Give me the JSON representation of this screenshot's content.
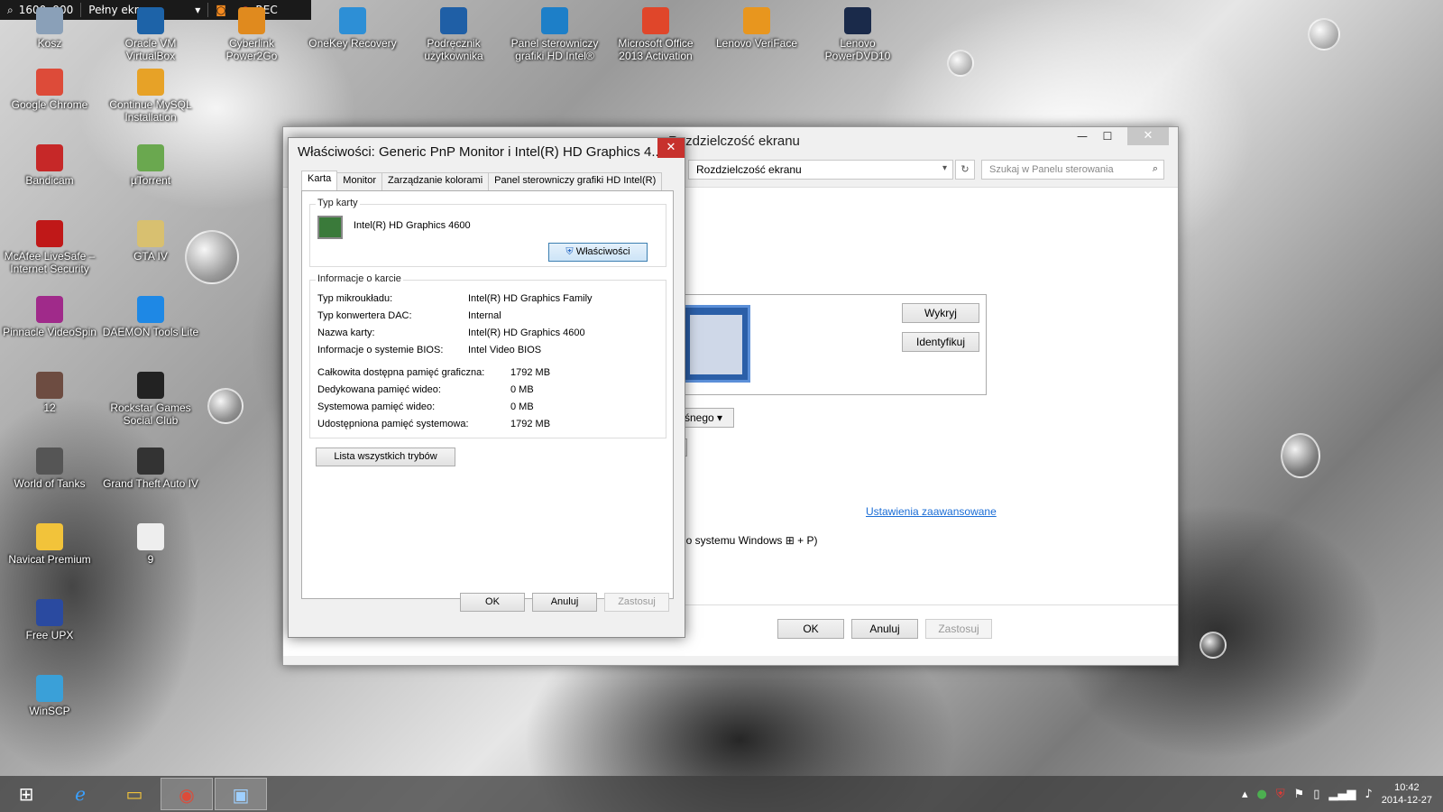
{
  "recorder": {
    "resolution": "1600x900",
    "mode": "Pełny ekran",
    "rec_label": "REC"
  },
  "desktop_icons": [
    {
      "label": "Kosz",
      "icon": "recycle-bin-icon",
      "color": "#8aa0b8"
    },
    {
      "label": "Oracle VM VirtualBox",
      "icon": "virtualbox-icon",
      "color": "#1d63a8"
    },
    {
      "label": "Cyberlink Power2Go",
      "icon": "power2go-icon",
      "color": "#e08a1e"
    },
    {
      "label": "OneKey Recovery",
      "icon": "onekey-recovery-icon",
      "color": "#2d8fd6"
    },
    {
      "label": "Podręcznik użytkownika",
      "icon": "user-guide-icon",
      "color": "#1f5fa6"
    },
    {
      "label": "Panel sterowniczy grafiki HD Intel®",
      "icon": "intel-graphics-icon",
      "color": "#1d7fc8"
    },
    {
      "label": "Microsoft Office 2013 Activation",
      "icon": "office-icon",
      "color": "#e0462a"
    },
    {
      "label": "Lenovo VeriFace",
      "icon": "veriface-icon",
      "color": "#e8961e"
    },
    {
      "label": "Lenovo PowerDVD10",
      "icon": "powerdvd-icon",
      "color": "#1a2a4a"
    },
    {
      "label": "Google Chrome",
      "icon": "chrome-icon",
      "color": "#dd4b39"
    },
    {
      "label": "Continue MySQL Installation",
      "icon": "mysql-icon",
      "color": "#e7a227"
    },
    {
      "label": "Bandicam",
      "icon": "bandicam-icon",
      "color": "#c62828"
    },
    {
      "label": "µTorrent",
      "icon": "utorrent-icon",
      "color": "#6aa84f"
    },
    {
      "label": "McAfee LiveSafe – Internet Security",
      "icon": "mcafee-icon",
      "color": "#c01818"
    },
    {
      "label": "GTA IV",
      "icon": "gta-iv-icon",
      "color": "#d8c070"
    },
    {
      "label": "Pinnacle VideoSpin",
      "icon": "videospin-icon",
      "color": "#a02a8a"
    },
    {
      "label": "DAEMON Tools Lite",
      "icon": "daemon-tools-icon",
      "color": "#1e88e5"
    },
    {
      "label": "12",
      "icon": "folder-12-icon",
      "color": "#6d4c41"
    },
    {
      "label": "Rockstar Games Social Club",
      "icon": "rockstar-icon",
      "color": "#222222"
    },
    {
      "label": "World of Tanks",
      "icon": "world-of-tanks-icon",
      "color": "#555555"
    },
    {
      "label": "Grand Theft Auto IV",
      "icon": "gta-icon",
      "color": "#333333"
    },
    {
      "label": "Navicat Premium",
      "icon": "navicat-icon",
      "color": "#f2c33a"
    },
    {
      "label": "9",
      "icon": "file-9-icon",
      "color": "#eeeeee"
    },
    {
      "label": "Free UPX",
      "icon": "upx-icon",
      "color": "#2a4aa0"
    },
    {
      "label": "WinSCP",
      "icon": "winscp-icon",
      "color": "#3aa0d8"
    }
  ],
  "back_window": {
    "title": "Rozdzielczość ekranu",
    "address": "Rozdzielczość ekranu",
    "search_placeholder": "Szukaj w Panelu sterowania",
    "detect_button": "Wykryj",
    "identify_button": "Identyfikuj",
    "select_partial": "śnego",
    "advanced_link": "Ustawienia zaawansowane",
    "projector_text": "go systemu Windows",
    "projector_suffix": "+ P)",
    "ok": "OK",
    "cancel": "Anuluj",
    "apply": "Zastosuj"
  },
  "dialog": {
    "title": "Właściwości: Generic PnP Monitor i Intel(R) HD Graphics 4...",
    "tabs": [
      {
        "label": "Karta",
        "active": true
      },
      {
        "label": "Monitor",
        "active": false
      },
      {
        "label": "Zarządzanie kolorami",
        "active": false
      },
      {
        "label": "Panel sterowniczy grafiki HD Intel(R)",
        "active": false
      }
    ],
    "adapter_group": "Typ karty",
    "adapter_name": "Intel(R) HD Graphics 4600",
    "properties_button": "Właściwości",
    "info_group": "Informacje o karcie",
    "info_rows": [
      {
        "label": "Typ mikroukładu:",
        "value": "Intel(R) HD Graphics Family"
      },
      {
        "label": "Typ konwertera DAC:",
        "value": "Internal"
      },
      {
        "label": "Nazwa karty:",
        "value": "Intel(R) HD Graphics 4600"
      },
      {
        "label": "Informacje o systemie BIOS:",
        "value": "Intel Video BIOS"
      }
    ],
    "memory_rows": [
      {
        "label": "Całkowita dostępna pamięć graficzna:",
        "value": "1792 MB"
      },
      {
        "label": "Dedykowana pamięć wideo:",
        "value": "0 MB"
      },
      {
        "label": "Systemowa pamięć wideo:",
        "value": "0 MB"
      },
      {
        "label": "Udostępniona pamięć systemowa:",
        "value": "1792 MB"
      }
    ],
    "list_modes_button": "Lista wszystkich trybów",
    "ok": "OK",
    "cancel": "Anuluj",
    "apply": "Zastosuj"
  },
  "taskbar": {
    "items": [
      {
        "icon": "windows-start-icon",
        "active": false
      },
      {
        "icon": "internet-explorer-icon",
        "active": false
      },
      {
        "icon": "file-explorer-icon",
        "active": false
      },
      {
        "icon": "chrome-icon",
        "active": true
      },
      {
        "icon": "control-panel-icon",
        "active": true
      }
    ],
    "time": "10:42",
    "date": "2014-12-27"
  }
}
